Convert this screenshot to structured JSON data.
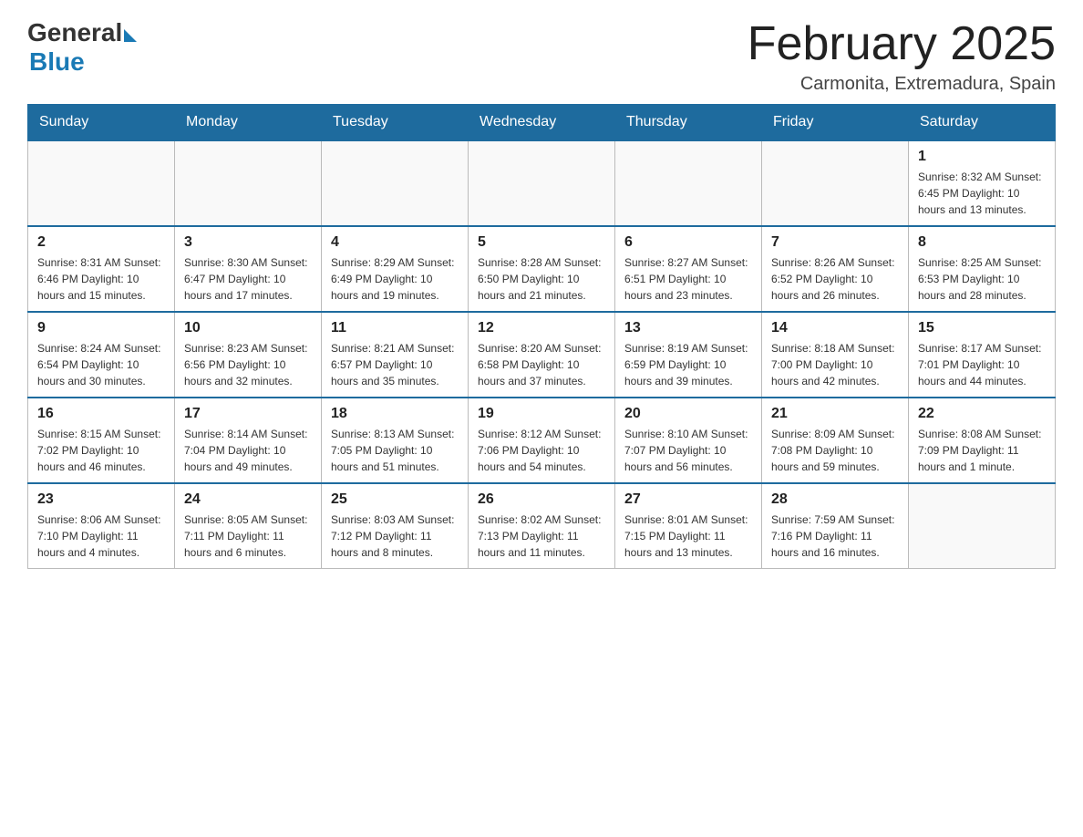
{
  "header": {
    "logo_general": "General",
    "logo_blue": "Blue",
    "title": "February 2025",
    "subtitle": "Carmonita, Extremadura, Spain"
  },
  "weekdays": [
    "Sunday",
    "Monday",
    "Tuesday",
    "Wednesday",
    "Thursday",
    "Friday",
    "Saturday"
  ],
  "weeks": [
    [
      {
        "day": "",
        "info": ""
      },
      {
        "day": "",
        "info": ""
      },
      {
        "day": "",
        "info": ""
      },
      {
        "day": "",
        "info": ""
      },
      {
        "day": "",
        "info": ""
      },
      {
        "day": "",
        "info": ""
      },
      {
        "day": "1",
        "info": "Sunrise: 8:32 AM\nSunset: 6:45 PM\nDaylight: 10 hours and 13 minutes."
      }
    ],
    [
      {
        "day": "2",
        "info": "Sunrise: 8:31 AM\nSunset: 6:46 PM\nDaylight: 10 hours and 15 minutes."
      },
      {
        "day": "3",
        "info": "Sunrise: 8:30 AM\nSunset: 6:47 PM\nDaylight: 10 hours and 17 minutes."
      },
      {
        "day": "4",
        "info": "Sunrise: 8:29 AM\nSunset: 6:49 PM\nDaylight: 10 hours and 19 minutes."
      },
      {
        "day": "5",
        "info": "Sunrise: 8:28 AM\nSunset: 6:50 PM\nDaylight: 10 hours and 21 minutes."
      },
      {
        "day": "6",
        "info": "Sunrise: 8:27 AM\nSunset: 6:51 PM\nDaylight: 10 hours and 23 minutes."
      },
      {
        "day": "7",
        "info": "Sunrise: 8:26 AM\nSunset: 6:52 PM\nDaylight: 10 hours and 26 minutes."
      },
      {
        "day": "8",
        "info": "Sunrise: 8:25 AM\nSunset: 6:53 PM\nDaylight: 10 hours and 28 minutes."
      }
    ],
    [
      {
        "day": "9",
        "info": "Sunrise: 8:24 AM\nSunset: 6:54 PM\nDaylight: 10 hours and 30 minutes."
      },
      {
        "day": "10",
        "info": "Sunrise: 8:23 AM\nSunset: 6:56 PM\nDaylight: 10 hours and 32 minutes."
      },
      {
        "day": "11",
        "info": "Sunrise: 8:21 AM\nSunset: 6:57 PM\nDaylight: 10 hours and 35 minutes."
      },
      {
        "day": "12",
        "info": "Sunrise: 8:20 AM\nSunset: 6:58 PM\nDaylight: 10 hours and 37 minutes."
      },
      {
        "day": "13",
        "info": "Sunrise: 8:19 AM\nSunset: 6:59 PM\nDaylight: 10 hours and 39 minutes."
      },
      {
        "day": "14",
        "info": "Sunrise: 8:18 AM\nSunset: 7:00 PM\nDaylight: 10 hours and 42 minutes."
      },
      {
        "day": "15",
        "info": "Sunrise: 8:17 AM\nSunset: 7:01 PM\nDaylight: 10 hours and 44 minutes."
      }
    ],
    [
      {
        "day": "16",
        "info": "Sunrise: 8:15 AM\nSunset: 7:02 PM\nDaylight: 10 hours and 46 minutes."
      },
      {
        "day": "17",
        "info": "Sunrise: 8:14 AM\nSunset: 7:04 PM\nDaylight: 10 hours and 49 minutes."
      },
      {
        "day": "18",
        "info": "Sunrise: 8:13 AM\nSunset: 7:05 PM\nDaylight: 10 hours and 51 minutes."
      },
      {
        "day": "19",
        "info": "Sunrise: 8:12 AM\nSunset: 7:06 PM\nDaylight: 10 hours and 54 minutes."
      },
      {
        "day": "20",
        "info": "Sunrise: 8:10 AM\nSunset: 7:07 PM\nDaylight: 10 hours and 56 minutes."
      },
      {
        "day": "21",
        "info": "Sunrise: 8:09 AM\nSunset: 7:08 PM\nDaylight: 10 hours and 59 minutes."
      },
      {
        "day": "22",
        "info": "Sunrise: 8:08 AM\nSunset: 7:09 PM\nDaylight: 11 hours and 1 minute."
      }
    ],
    [
      {
        "day": "23",
        "info": "Sunrise: 8:06 AM\nSunset: 7:10 PM\nDaylight: 11 hours and 4 minutes."
      },
      {
        "day": "24",
        "info": "Sunrise: 8:05 AM\nSunset: 7:11 PM\nDaylight: 11 hours and 6 minutes."
      },
      {
        "day": "25",
        "info": "Sunrise: 8:03 AM\nSunset: 7:12 PM\nDaylight: 11 hours and 8 minutes."
      },
      {
        "day": "26",
        "info": "Sunrise: 8:02 AM\nSunset: 7:13 PM\nDaylight: 11 hours and 11 minutes."
      },
      {
        "day": "27",
        "info": "Sunrise: 8:01 AM\nSunset: 7:15 PM\nDaylight: 11 hours and 13 minutes."
      },
      {
        "day": "28",
        "info": "Sunrise: 7:59 AM\nSunset: 7:16 PM\nDaylight: 11 hours and 16 minutes."
      },
      {
        "day": "",
        "info": ""
      }
    ]
  ]
}
